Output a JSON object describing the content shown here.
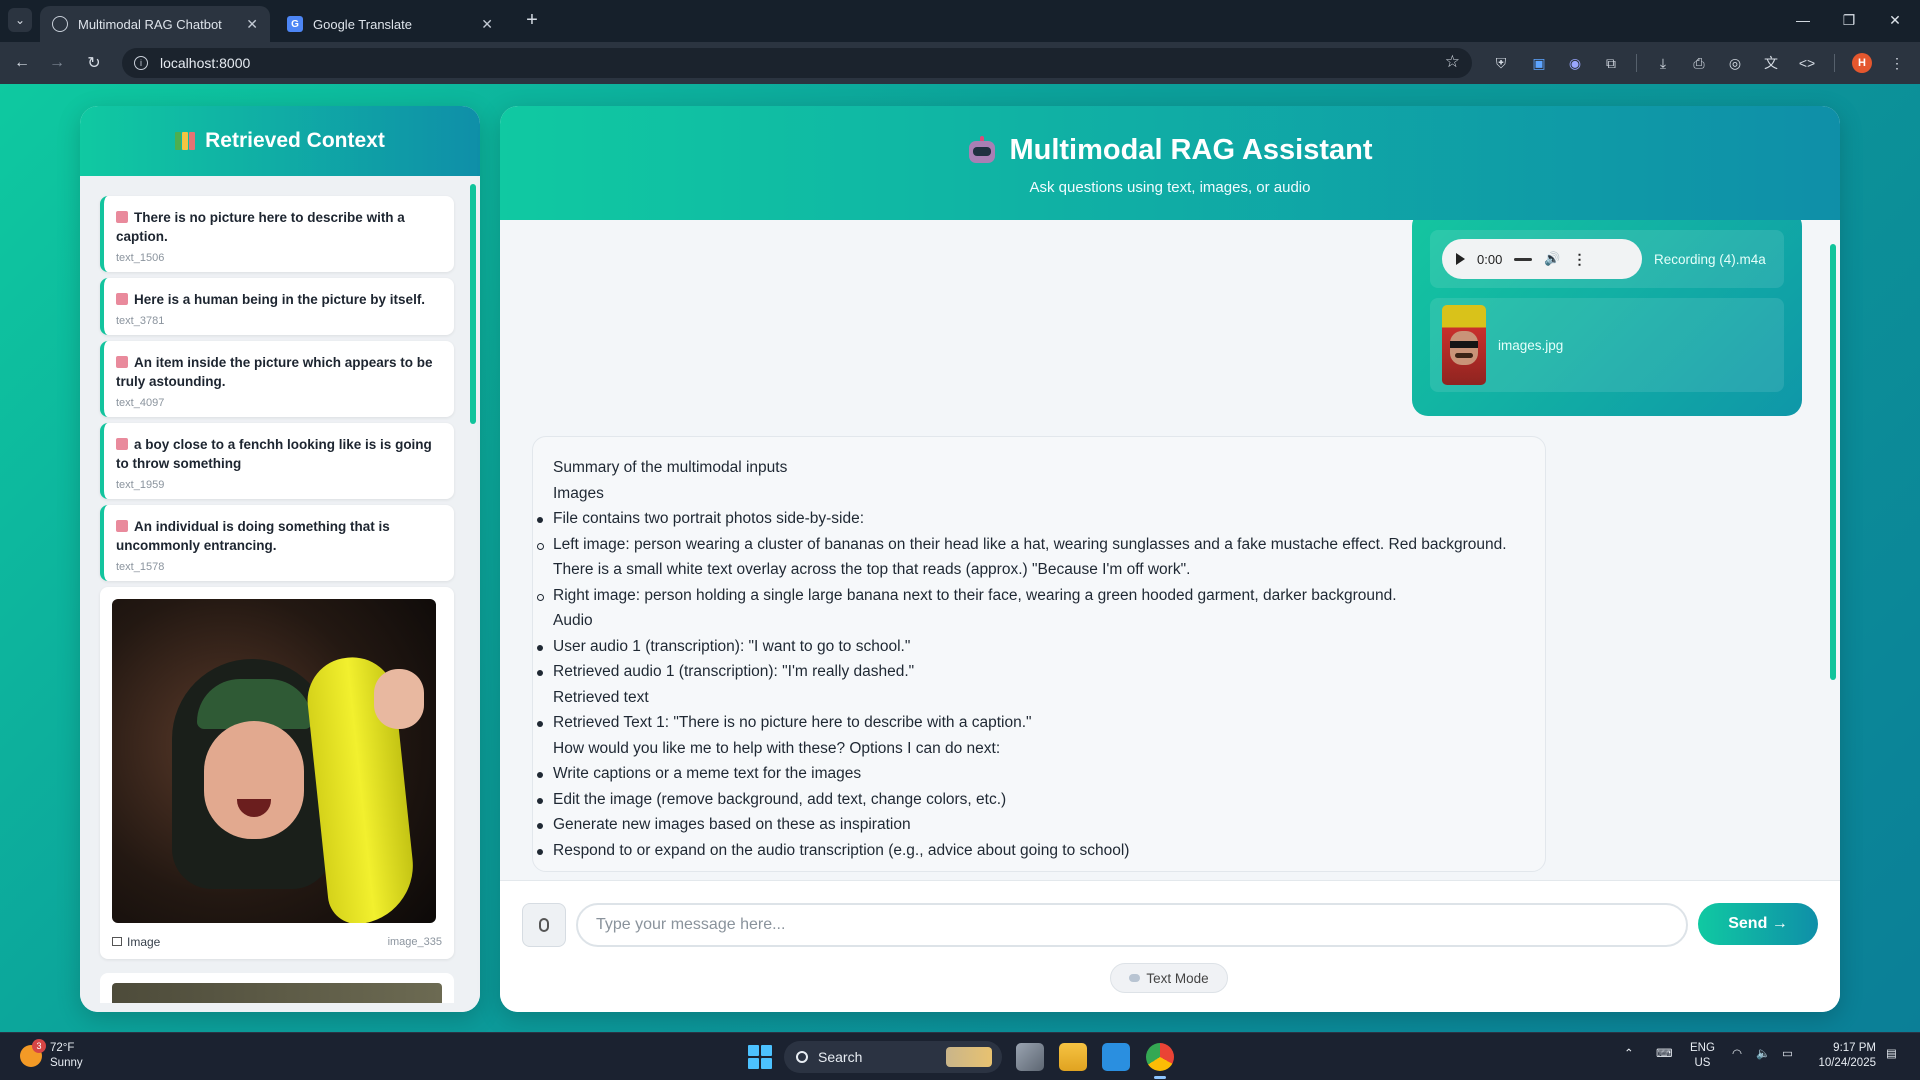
{
  "browser": {
    "tabs": [
      {
        "title": "Multimodal RAG Chatbot",
        "active": true
      },
      {
        "title": "Google Translate",
        "active": false
      }
    ],
    "url": "localhost:8000",
    "profile_initial": "H"
  },
  "context_panel": {
    "title": "Retrieved Context",
    "items": [
      {
        "text": "There is no picture here to describe with a caption.",
        "id": "text_1506"
      },
      {
        "text": "Here is a human being in the picture by itself.",
        "id": "text_3781"
      },
      {
        "text": "An item inside the picture which appears to be truly astounding.",
        "id": "text_4097"
      },
      {
        "text": "a boy close to a fenchh looking like is is going to throw something",
        "id": "text_1959"
      },
      {
        "text": "An individual is doing something that is uncommonly entrancing.",
        "id": "text_1578"
      }
    ],
    "image_card": {
      "label": "Image",
      "id": "image_335"
    }
  },
  "chat": {
    "title": "Multimodal RAG Assistant",
    "subtitle": "Ask questions using text, images, or audio",
    "user_message": {
      "audio": {
        "time": "0:00",
        "filename": "Recording (4).m4a"
      },
      "image": {
        "filename": "images.jpg"
      }
    },
    "bot_message": {
      "lines": [
        {
          "type": "p",
          "text": "Summary of the multimodal inputs"
        },
        {
          "type": "p",
          "text": "Images"
        },
        {
          "type": "li",
          "text": "File contains two portrait photos side-by-side:"
        },
        {
          "type": "sub",
          "text": "Left image: person wearing a cluster of bananas on their head like a hat, wearing sunglasses and a fake mustache effect. Red background. There is a small white text overlay across the top that reads (approx.) \"Because I'm off work\"."
        },
        {
          "type": "sub",
          "text": "Right image: person holding a single large banana next to their face, wearing a green hooded garment, darker background."
        },
        {
          "type": "p",
          "text": "Audio"
        },
        {
          "type": "li",
          "text": "User audio 1 (transcription): \"I want to go to school.\""
        },
        {
          "type": "li",
          "text": "Retrieved audio 1 (transcription): \"I'm really dashed.\""
        },
        {
          "type": "p",
          "text": "Retrieved text"
        },
        {
          "type": "li",
          "text": "Retrieved Text 1: \"There is no picture here to describe with a caption.\""
        },
        {
          "type": "p",
          "text": "How would you like me to help with these? Options I can do next:"
        },
        {
          "type": "li",
          "text": "Write captions or a meme text for the images"
        },
        {
          "type": "li",
          "text": "Edit the image (remove background, add text, change colors, etc.)"
        },
        {
          "type": "li",
          "text": "Generate new images based on these as inspiration"
        },
        {
          "type": "li",
          "text": "Respond to or expand on the audio transcription (e.g., advice about going to school)"
        }
      ]
    },
    "input": {
      "placeholder": "Type your message here...",
      "value": ""
    },
    "send_label": "Send →",
    "mode_label": "Text Mode"
  },
  "taskbar": {
    "weather_temp": "72°F",
    "weather_desc": "Sunny",
    "weather_badge": "3",
    "search_label": "Search",
    "lang_top": "ENG",
    "lang_bottom": "US",
    "time": "9:17 PM",
    "date": "10/24/2025"
  },
  "colors": {
    "accent": "#10c9a2",
    "accent_dark": "#0f8fa8"
  }
}
